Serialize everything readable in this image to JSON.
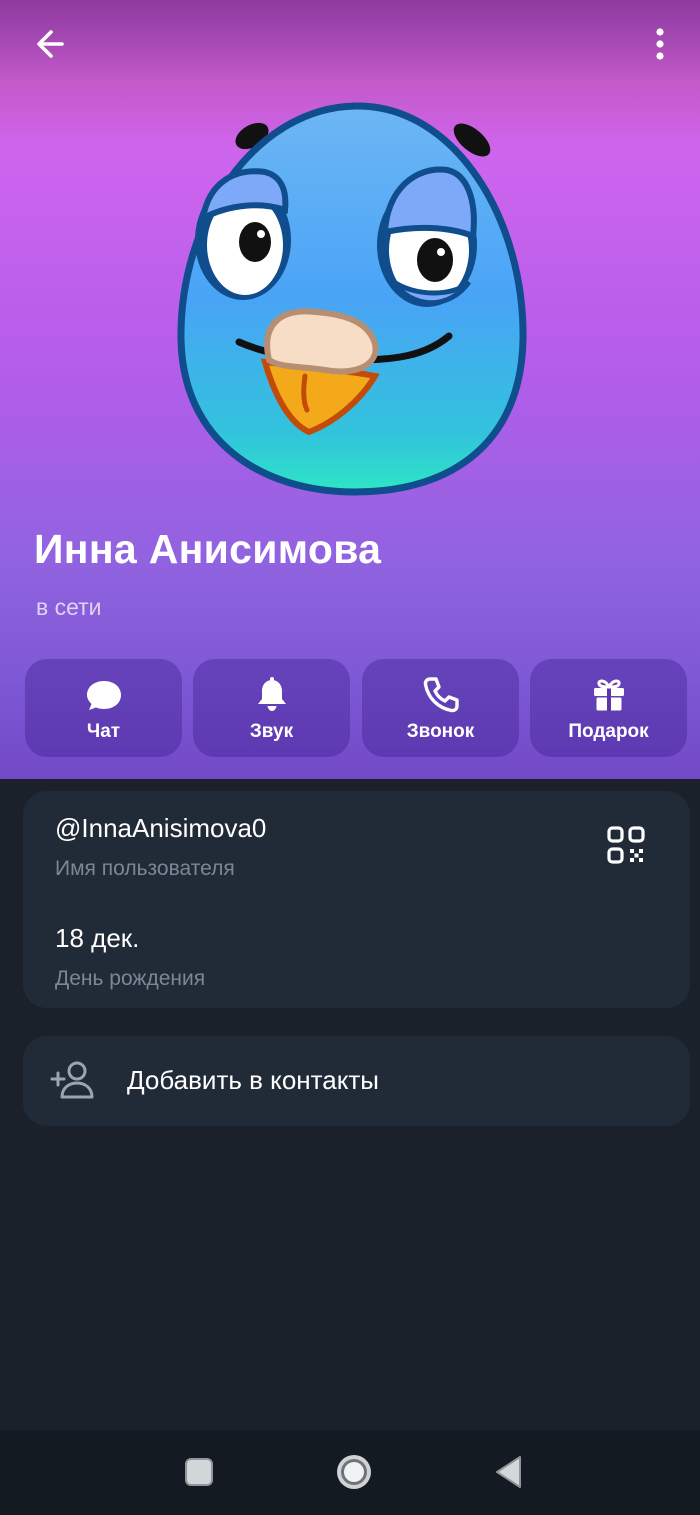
{
  "profile": {
    "name": "Инна Анисимова",
    "status": "в сети"
  },
  "actions": [
    {
      "label": "Чат",
      "icon": "chat-bubble-icon"
    },
    {
      "label": "Звук",
      "icon": "bell-icon"
    },
    {
      "label": "Звонок",
      "icon": "phone-icon"
    },
    {
      "label": "Подарок",
      "icon": "gift-icon"
    }
  ],
  "info": {
    "username": "@InnaAnisimova0",
    "username_label": "Имя пользователя",
    "birthday": "18 дек.",
    "birthday_label": "День рождения"
  },
  "add_contact": {
    "label": "Добавить в контакты",
    "icon": "add-person-icon"
  },
  "icons": {
    "back": "arrow-left-icon",
    "menu": "more-vertical-icon",
    "qr": "qr-code-icon",
    "avatar": "blue-bird-sticker"
  },
  "navigation": {
    "buttons": [
      "recents-square-icon",
      "home-circle-icon",
      "back-triangle-icon"
    ]
  },
  "colors": {
    "background": "#1a212b",
    "card": "#212b37",
    "secondary_text": "#7b8794",
    "hero_top": "#d062d8",
    "hero_bottom": "#7249c6",
    "action_button": "#55339f"
  }
}
